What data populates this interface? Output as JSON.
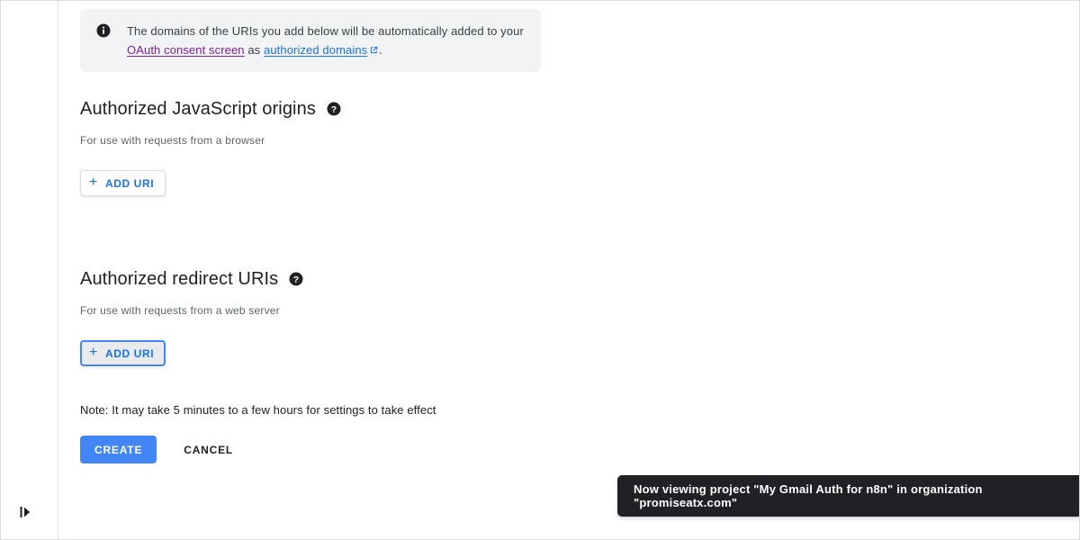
{
  "left_rail": {
    "expand_icon": "expand-panel-icon"
  },
  "info_banner": {
    "icon": "info-icon",
    "text_part_1": "The domains of the URIs you add below will be automatically added to your ",
    "link_oauth": "OAuth consent screen",
    "text_part_2": " as ",
    "link_domains": "authorized domains",
    "external_icon": "external-link-icon",
    "text_part_3": "."
  },
  "sections": [
    {
      "title": "Authorized JavaScript origins",
      "help_icon": "help-icon",
      "subtitle": "For use with requests from a browser",
      "add_button_label": "ADD URI",
      "add_button_plus": "+",
      "focused": false
    },
    {
      "title": "Authorized redirect URIs",
      "help_icon": "help-icon",
      "subtitle": "For use with requests from a web server",
      "add_button_label": "ADD URI",
      "add_button_plus": "+",
      "focused": true
    }
  ],
  "note": "Note: It may take 5 minutes to a few hours for settings to take effect",
  "actions": {
    "create_label": "CREATE",
    "cancel_label": "CANCEL",
    "create_color": "#4285f4"
  },
  "snackbar": {
    "message": "Now viewing project \"My Gmail Auth for n8n\" in organization \"promiseatx.com\"",
    "background": "#202124"
  }
}
